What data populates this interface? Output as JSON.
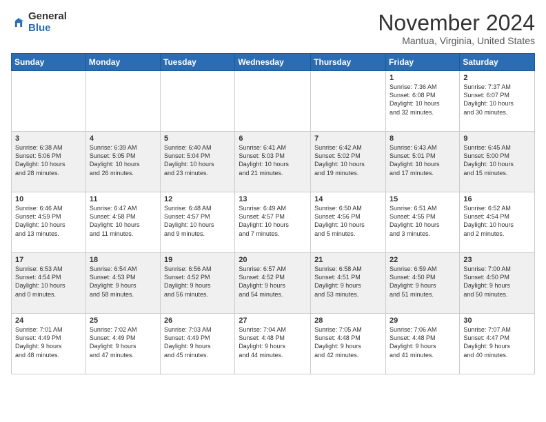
{
  "header": {
    "logo_general": "General",
    "logo_blue": "Blue",
    "title": "November 2024",
    "location": "Mantua, Virginia, United States"
  },
  "weekdays": [
    "Sunday",
    "Monday",
    "Tuesday",
    "Wednesday",
    "Thursday",
    "Friday",
    "Saturday"
  ],
  "weeks": [
    [
      {
        "day": "",
        "info": ""
      },
      {
        "day": "",
        "info": ""
      },
      {
        "day": "",
        "info": ""
      },
      {
        "day": "",
        "info": ""
      },
      {
        "day": "",
        "info": ""
      },
      {
        "day": "1",
        "info": "Sunrise: 7:36 AM\nSunset: 6:08 PM\nDaylight: 10 hours\nand 32 minutes."
      },
      {
        "day": "2",
        "info": "Sunrise: 7:37 AM\nSunset: 6:07 PM\nDaylight: 10 hours\nand 30 minutes."
      }
    ],
    [
      {
        "day": "3",
        "info": "Sunrise: 6:38 AM\nSunset: 5:06 PM\nDaylight: 10 hours\nand 28 minutes."
      },
      {
        "day": "4",
        "info": "Sunrise: 6:39 AM\nSunset: 5:05 PM\nDaylight: 10 hours\nand 26 minutes."
      },
      {
        "day": "5",
        "info": "Sunrise: 6:40 AM\nSunset: 5:04 PM\nDaylight: 10 hours\nand 23 minutes."
      },
      {
        "day": "6",
        "info": "Sunrise: 6:41 AM\nSunset: 5:03 PM\nDaylight: 10 hours\nand 21 minutes."
      },
      {
        "day": "7",
        "info": "Sunrise: 6:42 AM\nSunset: 5:02 PM\nDaylight: 10 hours\nand 19 minutes."
      },
      {
        "day": "8",
        "info": "Sunrise: 6:43 AM\nSunset: 5:01 PM\nDaylight: 10 hours\nand 17 minutes."
      },
      {
        "day": "9",
        "info": "Sunrise: 6:45 AM\nSunset: 5:00 PM\nDaylight: 10 hours\nand 15 minutes."
      }
    ],
    [
      {
        "day": "10",
        "info": "Sunrise: 6:46 AM\nSunset: 4:59 PM\nDaylight: 10 hours\nand 13 minutes."
      },
      {
        "day": "11",
        "info": "Sunrise: 6:47 AM\nSunset: 4:58 PM\nDaylight: 10 hours\nand 11 minutes."
      },
      {
        "day": "12",
        "info": "Sunrise: 6:48 AM\nSunset: 4:57 PM\nDaylight: 10 hours\nand 9 minutes."
      },
      {
        "day": "13",
        "info": "Sunrise: 6:49 AM\nSunset: 4:57 PM\nDaylight: 10 hours\nand 7 minutes."
      },
      {
        "day": "14",
        "info": "Sunrise: 6:50 AM\nSunset: 4:56 PM\nDaylight: 10 hours\nand 5 minutes."
      },
      {
        "day": "15",
        "info": "Sunrise: 6:51 AM\nSunset: 4:55 PM\nDaylight: 10 hours\nand 3 minutes."
      },
      {
        "day": "16",
        "info": "Sunrise: 6:52 AM\nSunset: 4:54 PM\nDaylight: 10 hours\nand 2 minutes."
      }
    ],
    [
      {
        "day": "17",
        "info": "Sunrise: 6:53 AM\nSunset: 4:54 PM\nDaylight: 10 hours\nand 0 minutes."
      },
      {
        "day": "18",
        "info": "Sunrise: 6:54 AM\nSunset: 4:53 PM\nDaylight: 9 hours\nand 58 minutes."
      },
      {
        "day": "19",
        "info": "Sunrise: 6:56 AM\nSunset: 4:52 PM\nDaylight: 9 hours\nand 56 minutes."
      },
      {
        "day": "20",
        "info": "Sunrise: 6:57 AM\nSunset: 4:52 PM\nDaylight: 9 hours\nand 54 minutes."
      },
      {
        "day": "21",
        "info": "Sunrise: 6:58 AM\nSunset: 4:51 PM\nDaylight: 9 hours\nand 53 minutes."
      },
      {
        "day": "22",
        "info": "Sunrise: 6:59 AM\nSunset: 4:50 PM\nDaylight: 9 hours\nand 51 minutes."
      },
      {
        "day": "23",
        "info": "Sunrise: 7:00 AM\nSunset: 4:50 PM\nDaylight: 9 hours\nand 50 minutes."
      }
    ],
    [
      {
        "day": "24",
        "info": "Sunrise: 7:01 AM\nSunset: 4:49 PM\nDaylight: 9 hours\nand 48 minutes."
      },
      {
        "day": "25",
        "info": "Sunrise: 7:02 AM\nSunset: 4:49 PM\nDaylight: 9 hours\nand 47 minutes."
      },
      {
        "day": "26",
        "info": "Sunrise: 7:03 AM\nSunset: 4:49 PM\nDaylight: 9 hours\nand 45 minutes."
      },
      {
        "day": "27",
        "info": "Sunrise: 7:04 AM\nSunset: 4:48 PM\nDaylight: 9 hours\nand 44 minutes."
      },
      {
        "day": "28",
        "info": "Sunrise: 7:05 AM\nSunset: 4:48 PM\nDaylight: 9 hours\nand 42 minutes."
      },
      {
        "day": "29",
        "info": "Sunrise: 7:06 AM\nSunset: 4:48 PM\nDaylight: 9 hours\nand 41 minutes."
      },
      {
        "day": "30",
        "info": "Sunrise: 7:07 AM\nSunset: 4:47 PM\nDaylight: 9 hours\nand 40 minutes."
      }
    ]
  ]
}
